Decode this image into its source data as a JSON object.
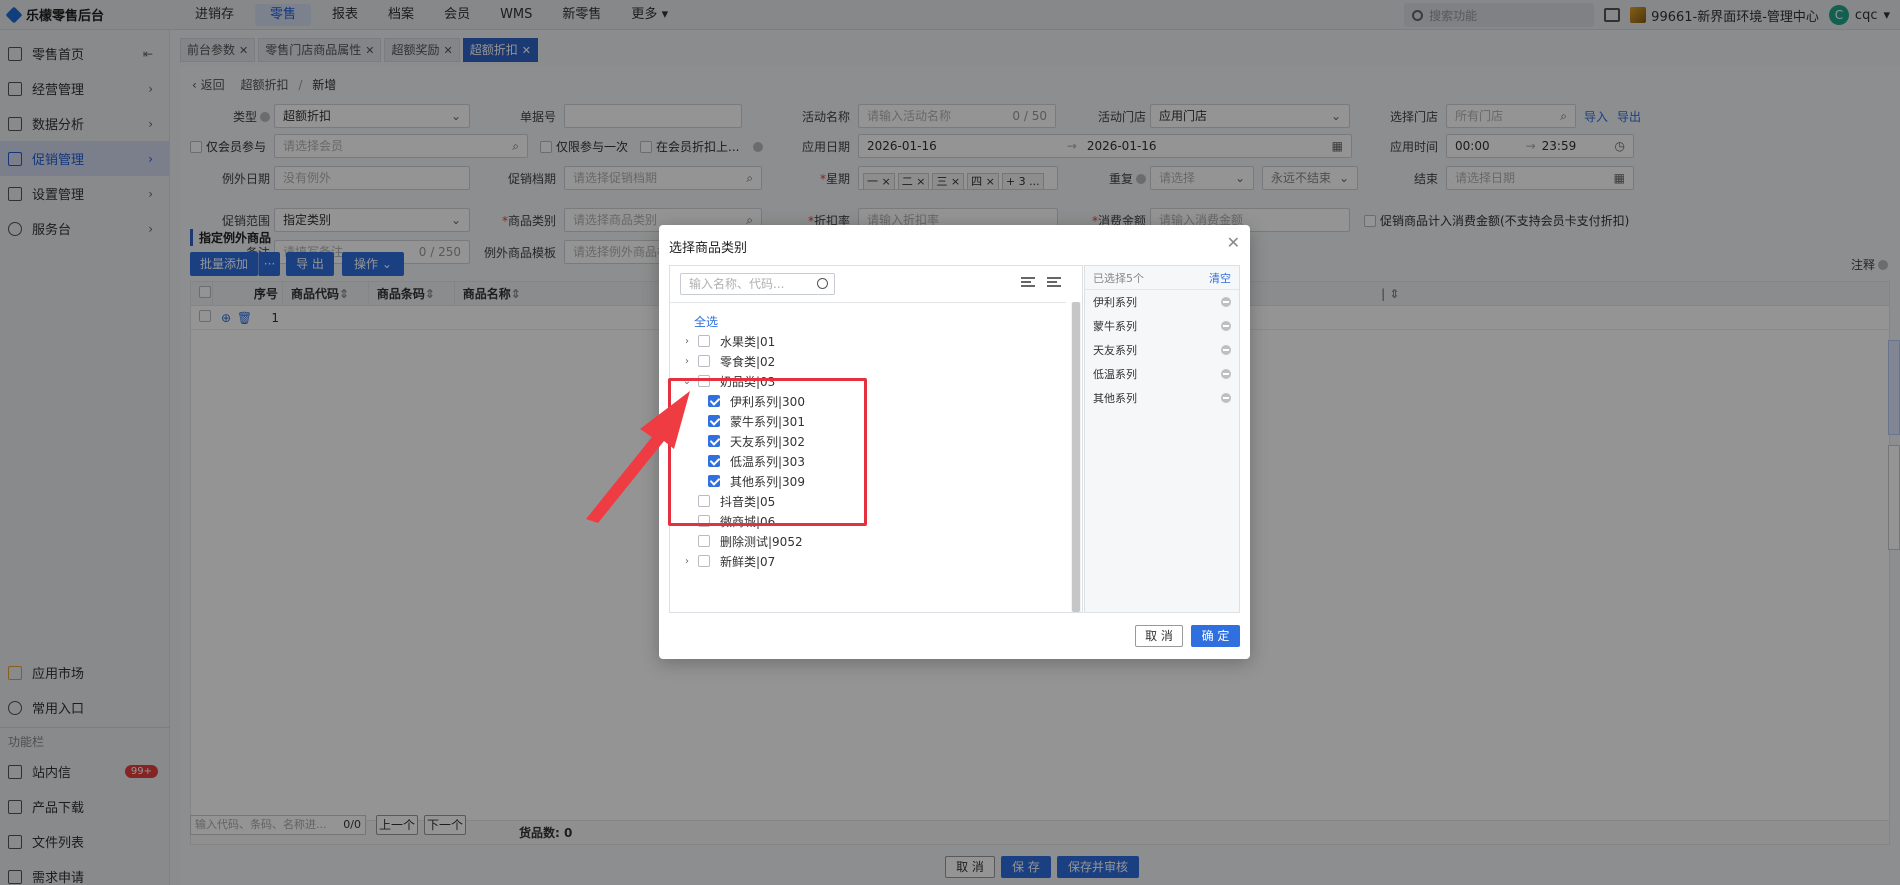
{
  "topbar": {
    "brand": "乐檬零售后台",
    "nav": [
      "进销存",
      "零售",
      "报表",
      "档案",
      "会员",
      "WMS",
      "新零售",
      "更多"
    ],
    "active_nav": "零售",
    "search_placeholder": "搜索功能",
    "store": "99661-新界面环境-管理中心",
    "user_initial": "C",
    "user": "cqc"
  },
  "sidebar": {
    "items": [
      {
        "label": "零售首页",
        "icon": "home-icon"
      },
      {
        "label": "经营管理",
        "icon": "chart-box-icon"
      },
      {
        "label": "数据分析",
        "icon": "trend-icon"
      },
      {
        "label": "促销管理",
        "icon": "promo-icon",
        "active": true
      },
      {
        "label": "设置管理",
        "icon": "folder-icon"
      },
      {
        "label": "服务台",
        "icon": "hexagon-icon"
      }
    ],
    "bottom": [
      {
        "label": "应用市场",
        "icon": "apps-icon"
      },
      {
        "label": "常用入口",
        "icon": "heart-icon"
      }
    ],
    "section_caption": "功能栏",
    "func": [
      {
        "label": "站内信",
        "icon": "mail-icon",
        "badge": "99+"
      },
      {
        "label": "产品下载",
        "icon": "download-icon"
      },
      {
        "label": "文件列表",
        "icon": "file-list-icon"
      },
      {
        "label": "需求申请",
        "icon": "request-icon"
      }
    ]
  },
  "tabs": [
    "前台参数",
    "零售门店商品属性",
    "超额奖励",
    "超额折扣"
  ],
  "active_tab": "超额折扣",
  "breadcrumb": {
    "back": "返回",
    "parent": "超额折扣",
    "current": "新增"
  },
  "form": {
    "type_label": "类型",
    "type_value": "超额折扣",
    "order_label": "单据号",
    "activity_name_label": "活动名称",
    "activity_name_placeholder": "请输入活动名称",
    "activity_name_count": "0 / 50",
    "activity_store_label": "活动门店",
    "activity_store_value": "应用门店",
    "select_store_label": "选择门店",
    "select_store_placeholder": "所有门店",
    "import": "导入",
    "export": "导出",
    "member_only": "仅会员参与",
    "member_placeholder": "请选择会员",
    "once_only": "仅限参与一次",
    "member_discount": "在会员折扣上...",
    "apply_date_label": "应用日期",
    "date_start": "2026-01-16",
    "date_end": "2026-01-16",
    "apply_time_label": "应用时间",
    "time_start": "00:00",
    "time_end": "23:59",
    "exception_date_label": "例外日期",
    "exception_date_placeholder": "没有例外",
    "promo_archive_label": "促销档期",
    "promo_archive_placeholder": "请选择促销档期",
    "week_label": "星期",
    "week_days": [
      "一",
      "二",
      "三",
      "四"
    ],
    "week_more": "+ 3 ...",
    "repeat_label": "重复",
    "repeat_placeholder": "请选择",
    "repeat_end": "永远不结束",
    "end_label": "结束",
    "end_placeholder": "请选择日期",
    "scope_label": "促销范围",
    "scope_value": "指定类别",
    "category_label": "商品类别",
    "category_placeholder": "请选择商品类别",
    "discount_label": "折扣率",
    "discount_placeholder": "请输入折扣率",
    "spend_label": "消费金额",
    "spend_placeholder": "请输入消费金额",
    "count_spend": "促销商品计入消费金额(不支持会员卡支付折扣)",
    "remark_label": "备注",
    "remark_placeholder": "请填写备注",
    "remark_count": "0 / 250",
    "exception_tpl_label": "例外商品模板",
    "exception_tpl_placeholder": "请选择例外商品模板"
  },
  "section": {
    "title": "指定例外商品",
    "batch_add": "批量添加",
    "more": "···",
    "export": "导 出",
    "operate": "操作",
    "note": "注释"
  },
  "table": {
    "headers": [
      "序号",
      "商品代码",
      "商品条码",
      "商品名称"
    ],
    "rows": [
      {
        "index": "1"
      }
    ],
    "footer": "货品数: 0"
  },
  "pager": {
    "placeholder": "输入代码、条码、名称进...",
    "count": "0/0",
    "prev": "上一个",
    "next": "下一个"
  },
  "footer_buttons": {
    "cancel": "取 消",
    "save": "保 存",
    "save_audit": "保存并审核"
  },
  "modal": {
    "title": "选择商品类别",
    "search_placeholder": "输入名称、代码...",
    "select_all": "全选",
    "tree": [
      {
        "label": "水果类|01",
        "level": 0,
        "expander": "right",
        "checked": false
      },
      {
        "label": "零食类|02",
        "level": 0,
        "expander": "right",
        "checked": false
      },
      {
        "label": "奶品类|03",
        "level": 0,
        "expander": "down",
        "checked": false
      },
      {
        "label": "伊利系列|300",
        "level": 1,
        "checked": true
      },
      {
        "label": "蒙牛系列|301",
        "level": 1,
        "checked": true
      },
      {
        "label": "天友系列|302",
        "level": 1,
        "checked": true
      },
      {
        "label": "低温系列|303",
        "level": 1,
        "checked": true
      },
      {
        "label": "其他系列|309",
        "level": 1,
        "checked": true
      },
      {
        "label": "抖音类|05",
        "level": 0,
        "checked": false
      },
      {
        "label": "微商城|06",
        "level": 0,
        "checked": false
      },
      {
        "label": "删除测试|9052",
        "level": 0,
        "checked": false
      },
      {
        "label": "新鲜类|07",
        "level": 0,
        "expander": "right",
        "checked": false
      }
    ],
    "selected_caption": "已选择5个",
    "clear": "清空",
    "selected": [
      "伊利系列",
      "蒙牛系列",
      "天友系列",
      "低温系列",
      "其他系列"
    ],
    "cancel": "取 消",
    "confirm": "确 定"
  },
  "colors": {
    "accent": "#2f6fe0",
    "highlight": "#e53040"
  }
}
